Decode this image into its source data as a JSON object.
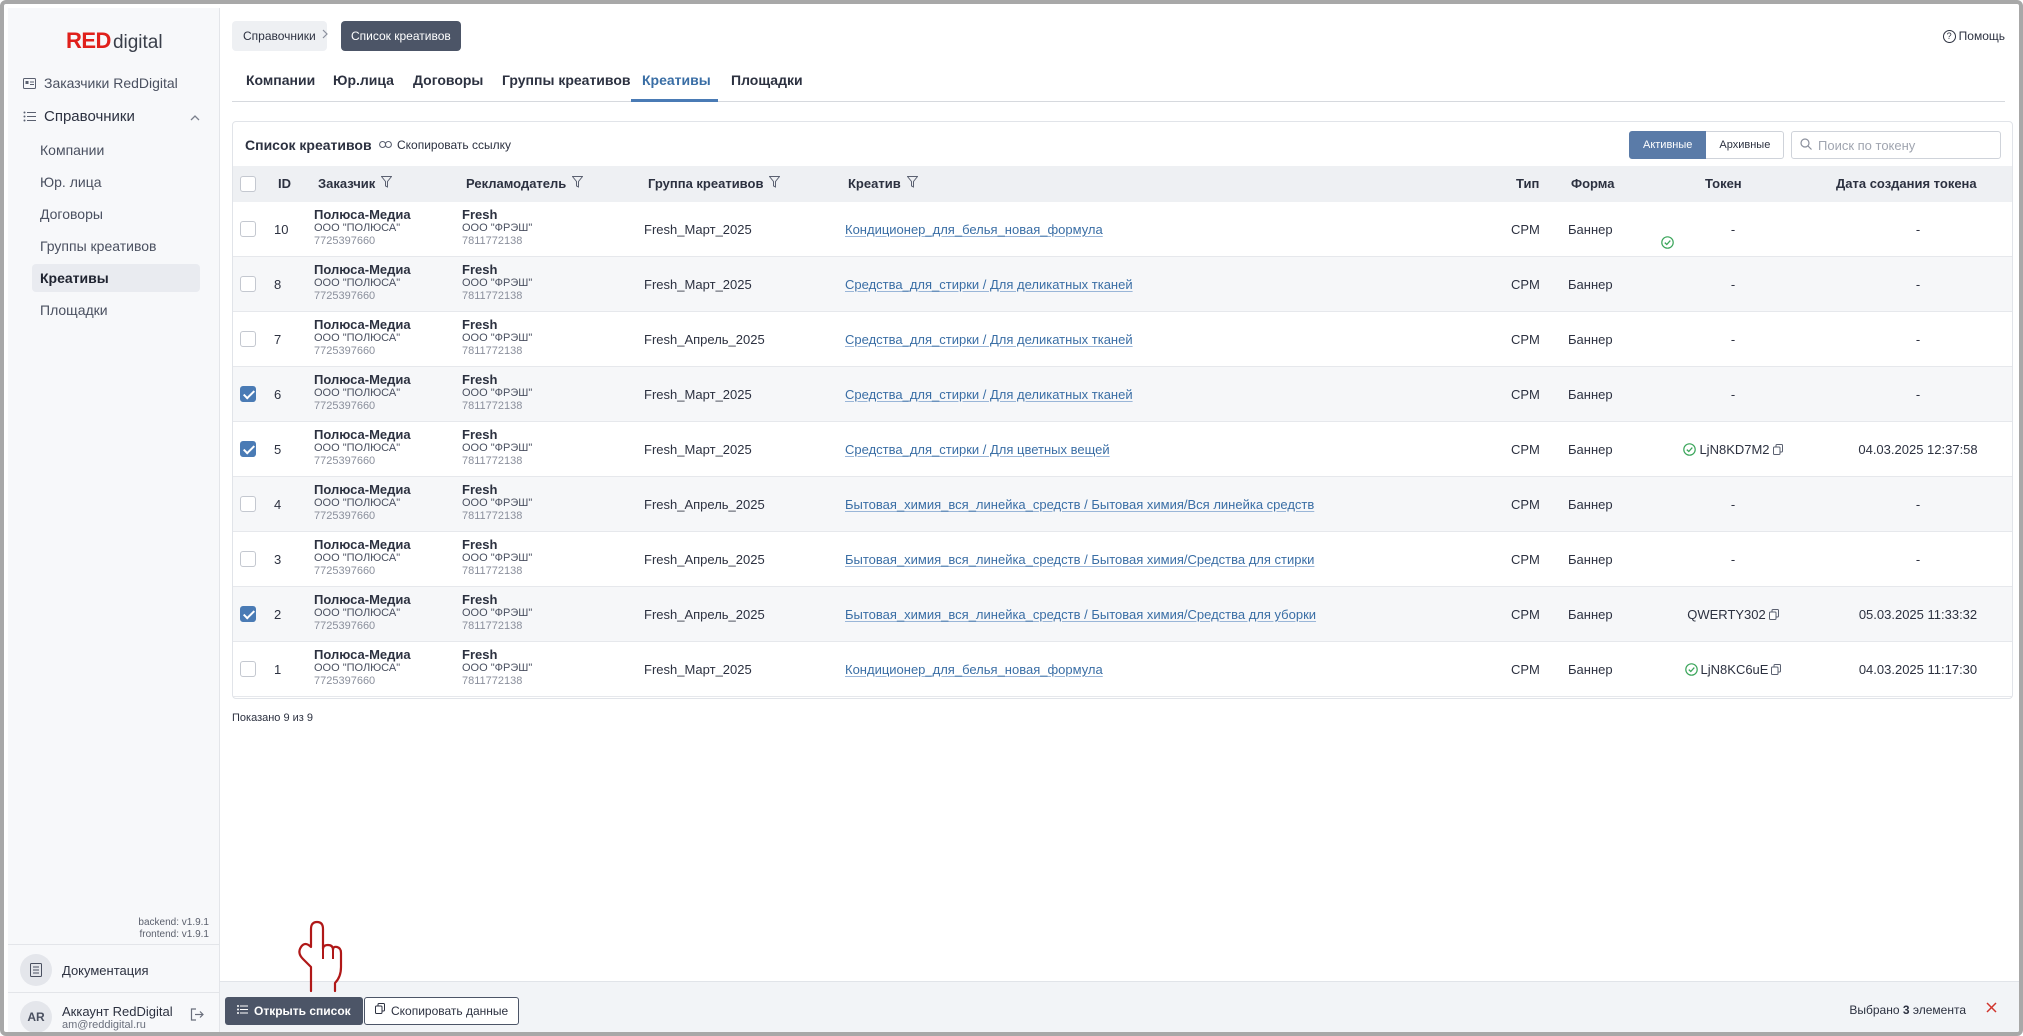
{
  "app": {
    "logo_red": "RED",
    "logo_digital": "digital",
    "help_label": "Помощь"
  },
  "sidebar": {
    "customers": "Заказчики RedDigital",
    "group_label": "Справочники",
    "items": [
      {
        "label": "Компании"
      },
      {
        "label": "Юр. лица"
      },
      {
        "label": "Договоры"
      },
      {
        "label": "Группы креативов"
      },
      {
        "label": "Креативы"
      },
      {
        "label": "Площадки"
      }
    ],
    "backend_version": "backend: v1.9.1",
    "frontend_version": "frontend: v1.9.1",
    "docs_label": "Документация",
    "account_initials": "AR",
    "account_name": "Аккаунт RedDigital",
    "account_email": "am@reddigital.ru"
  },
  "breadcrumb": {
    "root": "Справочники",
    "current": "Список креативов"
  },
  "tabs": [
    "Компании",
    "Юр.лица",
    "Договоры",
    "Группы креативов",
    "Креативы",
    "Площадки"
  ],
  "list": {
    "title": "Список креативов",
    "copy_link": "Скопировать ссылку",
    "filter_active": "Активные",
    "filter_archived": "Архивные",
    "search_placeholder": "Поиск по токену",
    "columns": {
      "id": "ID",
      "customer": "Заказчик",
      "advertiser": "Рекламодатель",
      "group": "Группа креативов",
      "creative": "Креатив",
      "type": "Тип",
      "form": "Форма",
      "token": "Токен",
      "token_date": "Дата создания токена"
    },
    "rows": [
      {
        "id": "10",
        "checked": false,
        "customer": "Полюса-Медиа",
        "customer_org": "ООО \"ПОЛЮСА\"",
        "customer_inn": "7725397660",
        "advertiser": "Fresh",
        "advertiser_org": "ООО \"ФРЭШ\"",
        "advertiser_inn": "7811772138",
        "group": "Fresh_Март_2025",
        "creative": "Кондиционер_для_белья_новая_формула",
        "type": "CPM",
        "form": "Баннер",
        "token": "-",
        "token_ok": true,
        "token_copy": false,
        "token_date": "-"
      },
      {
        "id": "8",
        "checked": false,
        "customer": "Полюса-Медиа",
        "customer_org": "ООО \"ПОЛЮСА\"",
        "customer_inn": "7725397660",
        "advertiser": "Fresh",
        "advertiser_org": "ООО \"ФРЭШ\"",
        "advertiser_inn": "7811772138",
        "group": "Fresh_Март_2025",
        "creative": "Средства_для_стирки / Для деликатных тканей",
        "type": "CPM",
        "form": "Баннер",
        "token": "-",
        "token_ok": false,
        "token_copy": false,
        "token_date": "-"
      },
      {
        "id": "7",
        "checked": false,
        "customer": "Полюса-Медиа",
        "customer_org": "ООО \"ПОЛЮСА\"",
        "customer_inn": "7725397660",
        "advertiser": "Fresh",
        "advertiser_org": "ООО \"ФРЭШ\"",
        "advertiser_inn": "7811772138",
        "group": "Fresh_Апрель_2025",
        "creative": "Средства_для_стирки / Для деликатных тканей",
        "type": "CPM",
        "form": "Баннер",
        "token": "-",
        "token_ok": false,
        "token_copy": false,
        "token_date": "-"
      },
      {
        "id": "6",
        "checked": true,
        "customer": "Полюса-Медиа",
        "customer_org": "ООО \"ПОЛЮСА\"",
        "customer_inn": "7725397660",
        "advertiser": "Fresh",
        "advertiser_org": "ООО \"ФРЭШ\"",
        "advertiser_inn": "7811772138",
        "group": "Fresh_Март_2025",
        "creative": "Средства_для_стирки / Для деликатных тканей",
        "type": "CPM",
        "form": "Баннер",
        "token": "-",
        "token_ok": false,
        "token_copy": false,
        "token_date": "-"
      },
      {
        "id": "5",
        "checked": true,
        "customer": "Полюса-Медиа",
        "customer_org": "ООО \"ПОЛЮСА\"",
        "customer_inn": "7725397660",
        "advertiser": "Fresh",
        "advertiser_org": "ООО \"ФРЭШ\"",
        "advertiser_inn": "7811772138",
        "group": "Fresh_Март_2025",
        "creative": "Средства_для_стирки / Для цветных вещей",
        "type": "CPM",
        "form": "Баннер",
        "token": "LjN8KD7M2",
        "token_ok": true,
        "token_copy": true,
        "token_date": "04.03.2025 12:37:58"
      },
      {
        "id": "4",
        "checked": false,
        "customer": "Полюса-Медиа",
        "customer_org": "ООО \"ПОЛЮСА\"",
        "customer_inn": "7725397660",
        "advertiser": "Fresh",
        "advertiser_org": "ООО \"ФРЭШ\"",
        "advertiser_inn": "7811772138",
        "group": "Fresh_Апрель_2025",
        "creative": "Бытовая_химия_вся_линейка_средств / Бытовая химия/Вся линейка средств",
        "type": "CPM",
        "form": "Баннер",
        "token": "-",
        "token_ok": false,
        "token_copy": false,
        "token_date": "-"
      },
      {
        "id": "3",
        "checked": false,
        "customer": "Полюса-Медиа",
        "customer_org": "ООО \"ПОЛЮСА\"",
        "customer_inn": "7725397660",
        "advertiser": "Fresh",
        "advertiser_org": "ООО \"ФРЭШ\"",
        "advertiser_inn": "7811772138",
        "group": "Fresh_Апрель_2025",
        "creative": "Бытовая_химия_вся_линейка_средств / Бытовая химия/Средства для стирки",
        "type": "CPM",
        "form": "Баннер",
        "token": "-",
        "token_ok": false,
        "token_copy": false,
        "token_date": "-"
      },
      {
        "id": "2",
        "checked": true,
        "customer": "Полюса-Медиа",
        "customer_org": "ООО \"ПОЛЮСА\"",
        "customer_inn": "7725397660",
        "advertiser": "Fresh",
        "advertiser_org": "ООО \"ФРЭШ\"",
        "advertiser_inn": "7811772138",
        "group": "Fresh_Апрель_2025",
        "creative": "Бытовая_химия_вся_линейка_средств / Бытовая химия/Средства для уборки",
        "type": "CPM",
        "form": "Баннер",
        "token": "QWERTY302",
        "token_ok": false,
        "token_copy": true,
        "token_date": "05.03.2025 11:33:32"
      },
      {
        "id": "1",
        "checked": false,
        "customer": "Полюса-Медиа",
        "customer_org": "ООО \"ПОЛЮСА\"",
        "customer_inn": "7725397660",
        "advertiser": "Fresh",
        "advertiser_org": "ООО \"ФРЭШ\"",
        "advertiser_inn": "7811772138",
        "group": "Fresh_Март_2025",
        "creative": "Кондиционер_для_белья_новая_формула",
        "type": "CPM",
        "form": "Баннер",
        "token": "LjN8KC6uE",
        "token_ok": true,
        "token_copy": true,
        "token_date": "04.03.2025 11:17:30"
      }
    ],
    "shown_text": "Показано 9 из 9"
  },
  "bottombar": {
    "open_list": "Открыть список",
    "copy_data": "Скопировать данные",
    "selected_prefix": "Выбрано ",
    "selected_count": "3",
    "selected_suffix": " элемента"
  },
  "colors": {
    "brand_red": "#e0201b",
    "accent_blue": "#4a7bb5",
    "dark_button": "#4c5567",
    "ok_green": "#3aa55a",
    "hand_pointer": "#b01818"
  },
  "icons": {
    "help": "question-circle-icon",
    "customers": "id-card-icon",
    "directories": "list-icon",
    "filter": "funnel-icon",
    "copy_link": "link-icon",
    "search": "search-icon",
    "token_ok": "check-circle-icon",
    "token_copy": "copy-icon",
    "docs": "document-icon",
    "logout": "logout-icon",
    "close": "close-icon",
    "pointer": "hand-pointer-icon"
  }
}
